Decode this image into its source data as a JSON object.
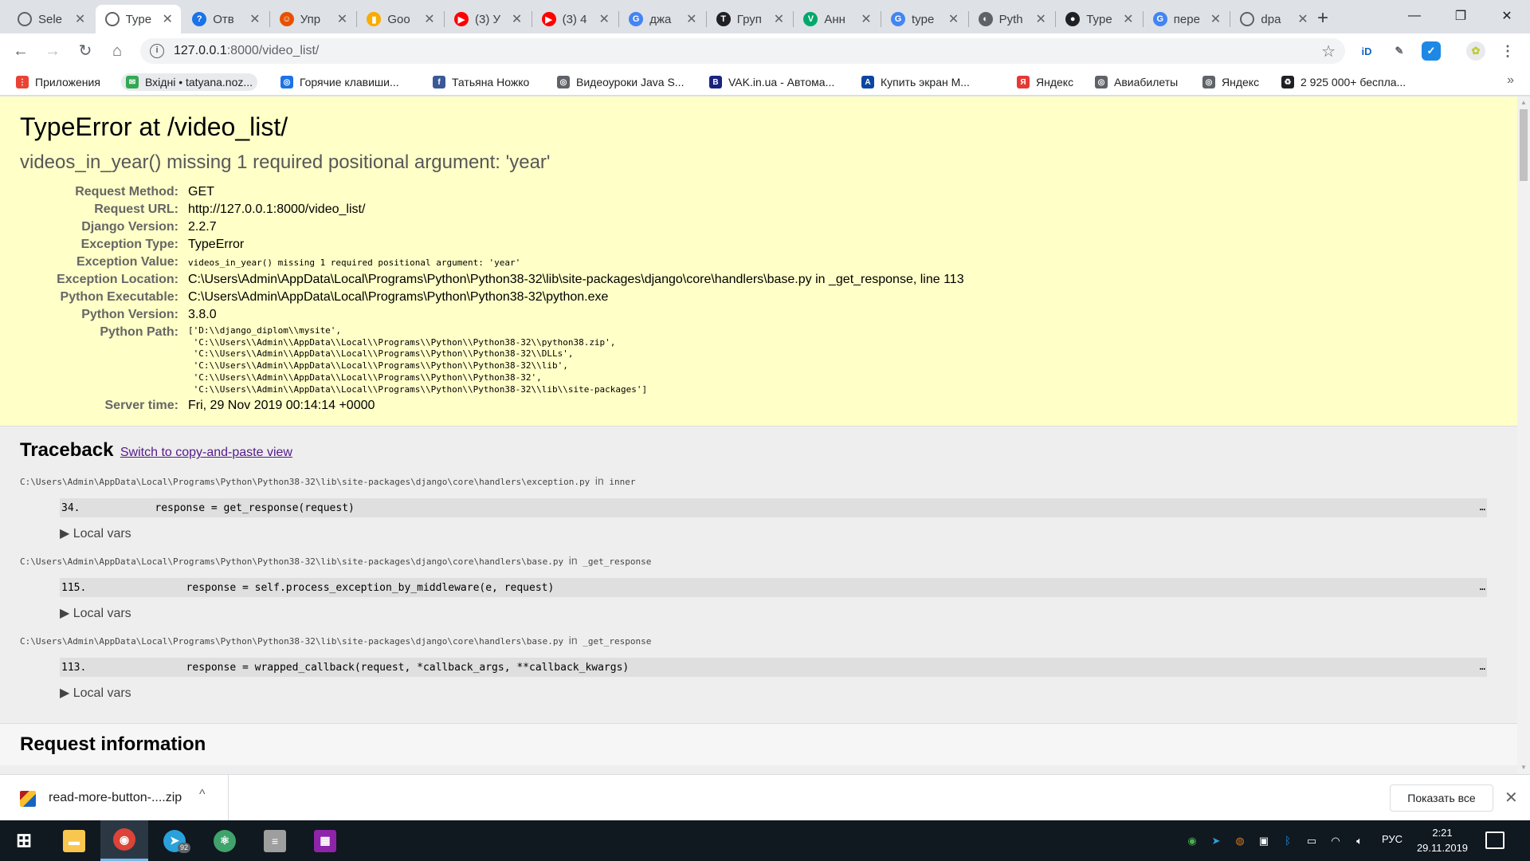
{
  "browser": {
    "tabs": [
      {
        "title": "Sele",
        "icon": "globe-icon",
        "color": "#5f6368",
        "glyph": ""
      },
      {
        "title": "Type",
        "icon": "globe-icon",
        "color": "#5f6368",
        "glyph": "",
        "active": true
      },
      {
        "title": "Отв",
        "icon": "question-icon",
        "color": "#1a73e8",
        "glyph": "?"
      },
      {
        "title": "Упр",
        "icon": "figure-icon",
        "color": "#e65100",
        "glyph": "☺"
      },
      {
        "title": "Goo",
        "icon": "analytics-icon",
        "color": "#f9ab00",
        "glyph": "▮"
      },
      {
        "title": "(3) У",
        "icon": "youtube-icon",
        "color": "#ff0000",
        "glyph": "▶"
      },
      {
        "title": "(3) 4",
        "icon": "youtube-icon",
        "color": "#ff0000",
        "glyph": "▶"
      },
      {
        "title": "джа",
        "icon": "google-icon",
        "color": "#4285f4",
        "glyph": "G"
      },
      {
        "title": "Груп",
        "icon": "telegraph-icon",
        "color": "#202124",
        "glyph": "T"
      },
      {
        "title": "Анн",
        "icon": "v-icon",
        "color": "#00a86b",
        "glyph": "V"
      },
      {
        "title": "type",
        "icon": "google-icon",
        "color": "#4285f4",
        "glyph": "G"
      },
      {
        "title": "Pyth",
        "icon": "python-icon",
        "color": "#5f6368",
        "glyph": "◐"
      },
      {
        "title": "Type",
        "icon": "github-icon",
        "color": "#202124",
        "glyph": "●"
      },
      {
        "title": "пере",
        "icon": "google-icon",
        "color": "#4285f4",
        "glyph": "G"
      },
      {
        "title": "dpa",
        "icon": "globe-icon",
        "color": "#5f6368",
        "glyph": ""
      }
    ],
    "new_tab": "+",
    "window_controls": {
      "minimize": "—",
      "maximize": "❐",
      "close": "✕"
    },
    "url_host": "127.0.0.1",
    "url_rest": ":8000/video_list/",
    "bookmarks": [
      {
        "label": "Приложения",
        "icon": "apps-grid-icon",
        "color": "#ea4335",
        "glyph": "⋮"
      },
      {
        "label": "Вхідні • tatyana.noz...",
        "icon": "mail-icon",
        "color": "#34a853",
        "glyph": "✉",
        "pill": true
      },
      {
        "label": "Горячие клавиши...",
        "icon": "globe-icon",
        "color": "#1a73e8",
        "glyph": "◎"
      },
      {
        "label": "Татьяна Ножко",
        "icon": "facebook-icon",
        "color": "#3b5998",
        "glyph": "f"
      },
      {
        "label": "Видеоуроки Java S...",
        "icon": "globe-icon",
        "color": "#5f6368",
        "glyph": "◎"
      },
      {
        "label": "VAK.in.ua - Автома...",
        "icon": "b-icon",
        "color": "#1a237e",
        "glyph": "B"
      },
      {
        "label": "Купить экран М...",
        "icon": "aks-icon",
        "color": "#0d47a1",
        "glyph": "A"
      },
      {
        "label": "Яндекс",
        "icon": "yandex-icon",
        "color": "#e53935",
        "glyph": "Я"
      },
      {
        "label": "Авиабилеты",
        "icon": "globe-icon",
        "color": "#5f6368",
        "glyph": "◎"
      },
      {
        "label": "Яндекс",
        "icon": "globe-icon",
        "color": "#5f6368",
        "glyph": "◎"
      },
      {
        "label": "2 925 000+ беспла...",
        "icon": "recycle-icon",
        "color": "#202124",
        "glyph": "♻"
      }
    ],
    "bookmarks_more": "»"
  },
  "page": {
    "title": "TypeError at /video_list/",
    "exception_message": "videos_in_year() missing 1 required positional argument: 'year'",
    "meta": [
      {
        "key": "Request Method:",
        "value": "GET"
      },
      {
        "key": "Request URL:",
        "value": "http://127.0.0.1:8000/video_list/"
      },
      {
        "key": "Django Version:",
        "value": "2.2.7"
      },
      {
        "key": "Exception Type:",
        "value": "TypeError"
      },
      {
        "key": "Exception Value:",
        "value": "videos_in_year() missing 1 required positional argument: 'year'",
        "mono": true
      },
      {
        "key": "Exception Location:",
        "value": "C:\\Users\\Admin\\AppData\\Local\\Programs\\Python\\Python38-32\\lib\\site-packages\\django\\core\\handlers\\base.py in _get_response, line 113"
      },
      {
        "key": "Python Executable:",
        "value": "C:\\Users\\Admin\\AppData\\Local\\Programs\\Python\\Python38-32\\python.exe"
      },
      {
        "key": "Python Version:",
        "value": "3.8.0"
      },
      {
        "key": "Python Path:",
        "value": "['D:\\\\django_diplom\\\\mysite',\n 'C:\\\\Users\\\\Admin\\\\AppData\\\\Local\\\\Programs\\\\Python\\\\Python38-32\\\\python38.zip',\n 'C:\\\\Users\\\\Admin\\\\AppData\\\\Local\\\\Programs\\\\Python\\\\Python38-32\\\\DLLs',\n 'C:\\\\Users\\\\Admin\\\\AppData\\\\Local\\\\Programs\\\\Python\\\\Python38-32\\\\lib',\n 'C:\\\\Users\\\\Admin\\\\AppData\\\\Local\\\\Programs\\\\Python\\\\Python38-32',\n 'C:\\\\Users\\\\Admin\\\\AppData\\\\Local\\\\Programs\\\\Python\\\\Python38-32\\\\lib\\\\site-packages']",
        "pre": true
      },
      {
        "key": "Server time:",
        "value": "Fri, 29 Nov 2019 00:14:14 +0000"
      }
    ],
    "traceback_title": "Traceback",
    "switch_link": "Switch to copy-and-paste view",
    "in_word": "in",
    "local_vars_label": "▶ Local vars",
    "ellipsis": "…",
    "frames": [
      {
        "file": "C:\\Users\\Admin\\AppData\\Local\\Programs\\Python\\Python38-32\\lib\\site-packages\\django\\core\\handlers\\exception.py",
        "function": "inner",
        "lineno": "34.",
        "code": "            response = get_response(request)"
      },
      {
        "file": "C:\\Users\\Admin\\AppData\\Local\\Programs\\Python\\Python38-32\\lib\\site-packages\\django\\core\\handlers\\base.py",
        "function": "_get_response",
        "lineno": "115.",
        "code": "                response = self.process_exception_by_middleware(e, request)"
      },
      {
        "file": "C:\\Users\\Admin\\AppData\\Local\\Programs\\Python\\Python38-32\\lib\\site-packages\\django\\core\\handlers\\base.py",
        "function": "_get_response",
        "lineno": "113.",
        "code": "                response = wrapped_callback(request, *callback_args, **callback_kwargs)"
      }
    ],
    "request_info_title": "Request information"
  },
  "downloads": {
    "file_name": "read-more-button-....zip",
    "show_all": "Показать все",
    "close": "✕",
    "chevron": "^"
  },
  "taskbar": {
    "apps": [
      {
        "name": "start-button",
        "icon": "windows-icon",
        "glyph": "⊞",
        "bg": "transparent"
      },
      {
        "name": "taskbar-explorer",
        "icon": "folder-icon",
        "glyph": "▬",
        "bg": "#f9c74f"
      },
      {
        "name": "taskbar-chrome",
        "icon": "chrome-icon",
        "glyph": "◉",
        "bg": "#db4437",
        "active": true
      },
      {
        "name": "taskbar-telegram",
        "icon": "telegram-icon",
        "glyph": "➤",
        "bg": "#2aa1da",
        "badge": "92"
      },
      {
        "name": "taskbar-atom",
        "icon": "atom-icon",
        "glyph": "⚛",
        "bg": "#3fa36b"
      },
      {
        "name": "taskbar-database",
        "icon": "database-icon",
        "glyph": "≡",
        "bg": "#9e9e9e"
      },
      {
        "name": "taskbar-winrar",
        "icon": "winrar-icon",
        "glyph": "▦",
        "bg": "#8e24aa"
      }
    ],
    "language": "РУС",
    "time": "2:21",
    "date": "29.11.2019"
  }
}
